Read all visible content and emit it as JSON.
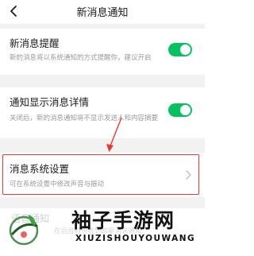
{
  "header": {
    "title": "新消息通知"
  },
  "settings": [
    {
      "title": "新消息提醒",
      "desc": "新的消息将以系统通知的方式提醒你，建议开启",
      "toggle_on": true
    },
    {
      "title": "通知显示消息详情",
      "desc": "关闭后，新的消息通知将不显示发送人和内容摘要",
      "toggle_on": true
    },
    {
      "title": "消息系统设置",
      "desc": "可在系统设置中修改声音与振动"
    }
  ],
  "partial_row": {
    "title": "语音通知",
    "desc": "在后台时想收到的新消息通知"
  },
  "watermark": {
    "name": "袖子手游网",
    "domain": "XIUZISHOUYOUWANG"
  },
  "colors": {
    "accent_green": "#07c160",
    "highlight_red": "#e53935"
  },
  "icons": {
    "back": "chevron-left",
    "row_arrow": "chevron-right"
  }
}
